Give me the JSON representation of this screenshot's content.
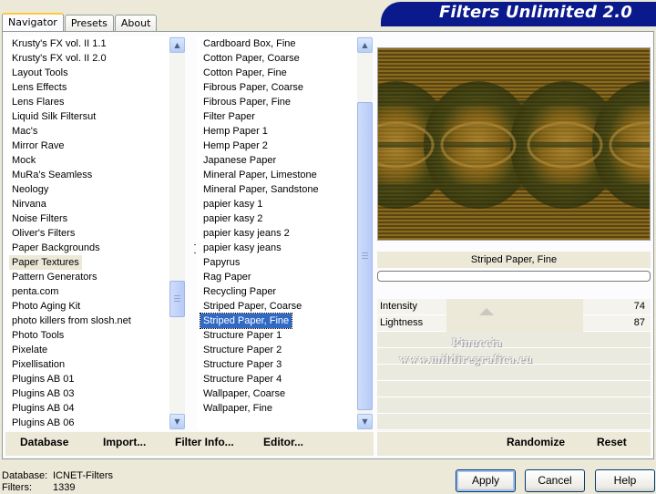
{
  "tabs": [
    {
      "label": "Navigator"
    },
    {
      "label": "Presets"
    },
    {
      "label": "About"
    }
  ],
  "app_title": "Filters Unlimited 2.0",
  "categories": [
    "Krusty's FX vol. II 1.1",
    "Krusty's FX vol. II 2.0",
    "Layout Tools",
    "Lens Effects",
    "Lens Flares",
    "Liquid Silk Filtersut",
    "Mac's",
    "Mirror Rave",
    "Mock",
    "MuRa's Seamless",
    "Neology",
    "Nirvana",
    "Noise Filters",
    "Oliver's Filters",
    "Paper Backgrounds",
    "Paper Textures",
    "Pattern Generators",
    "penta.com",
    "Photo Aging Kit",
    "photo killers from slosh.net",
    "Photo Tools",
    "Pixelate",
    "Pixellisation",
    "Plugins AB 01",
    "Plugins AB 03",
    "Plugins AB 04",
    "Plugins AB 06"
  ],
  "selected_category": "Paper Textures",
  "filters": [
    "Cardboard Box, Fine",
    "Cotton Paper, Coarse",
    "Cotton Paper, Fine",
    "Fibrous Paper, Coarse",
    "Fibrous Paper, Fine",
    "Filter Paper",
    "Hemp Paper 1",
    "Hemp Paper 2",
    "Japanese Paper",
    "Mineral Paper, Limestone",
    "Mineral Paper, Sandstone",
    "papier kasy 1",
    "papier kasy 2",
    "papier kasy jeans 2",
    "papier kasy jeans",
    "Papyrus",
    "Rag Paper",
    "Recycling Paper",
    "Striped Paper, Coarse",
    "Striped Paper, Fine",
    "Structure Paper 1",
    "Structure Paper 2",
    "Structure Paper 3",
    "Structure Paper 4",
    "Wallpaper, Coarse",
    "Wallpaper, Fine"
  ],
  "selected_filter": "Striped Paper, Fine",
  "preview": {
    "filter_name": "Striped Paper, Fine",
    "progress": 0
  },
  "parameters": [
    {
      "label": "Intensity",
      "value": "74",
      "level": 0.29
    },
    {
      "label": "Lightness",
      "value": "87",
      "level": 0.34
    }
  ],
  "watermark": {
    "line1": "Pinuccia",
    "line2": "www.mildiregrafica.eu"
  },
  "bottom_links": {
    "database": "Database",
    "import": "Import...",
    "filter_info": "Filter Info...",
    "editor": "Editor...",
    "randomize": "Randomize",
    "reset": "Reset"
  },
  "status": {
    "database_label": "Database:",
    "database_value": "ICNET-Filters",
    "filters_label": "Filters:",
    "filters_value": "1339"
  },
  "buttons": {
    "apply": "Apply",
    "cancel": "Cancel",
    "help": "Help"
  },
  "colors": {
    "title_bg": "#0a1a8c",
    "selection": "#316ac5",
    "window_bg": "#ece9d8"
  }
}
